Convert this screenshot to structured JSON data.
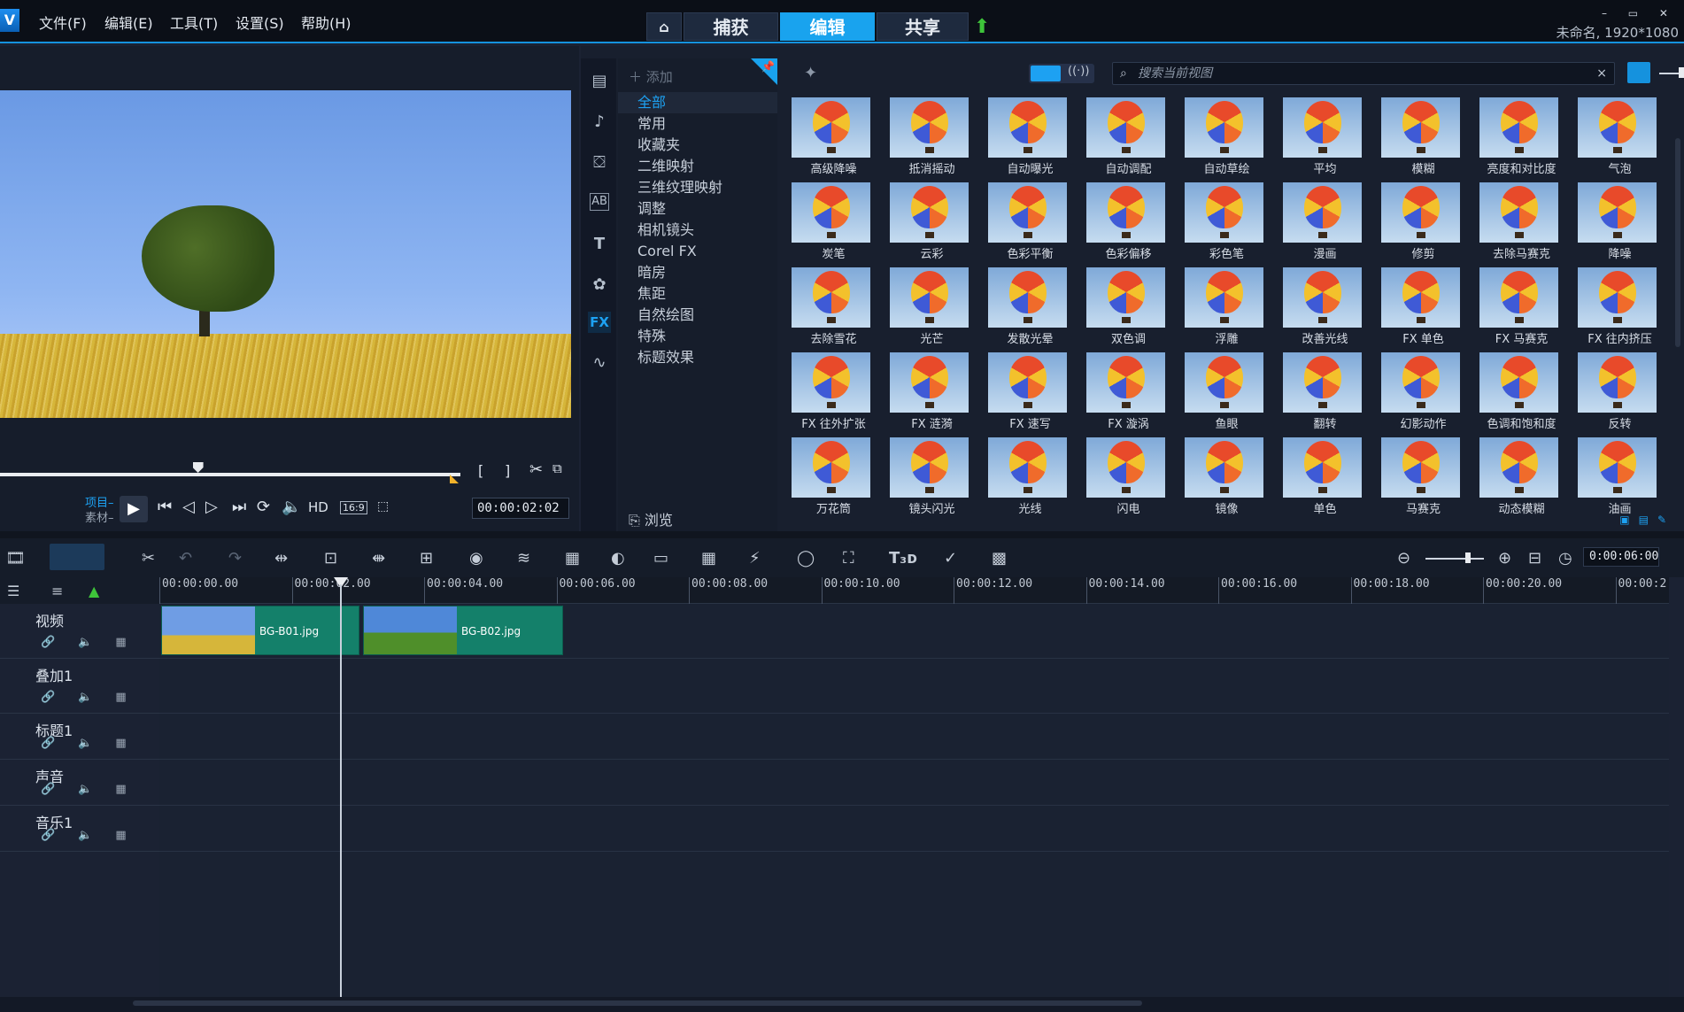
{
  "app": {
    "project_info": "未命名, 1920*1080",
    "window_controls": "– ▭ ✕"
  },
  "menu": [
    "文件(F)",
    "编辑(E)",
    "工具(T)",
    "设置(S)",
    "帮助(H)"
  ],
  "tabs": {
    "home": "⌂",
    "capture": "捕获",
    "edit": "编辑",
    "share": "共享",
    "active": "编辑"
  },
  "player": {
    "project_label": "项目–",
    "clip_label": "素材–",
    "timecode": "00:00:02:02",
    "hd_label": "HD",
    "aspect_label": "16:9",
    "scrub_position": 0.43
  },
  "library": {
    "add_label": "添加",
    "categories": [
      "全部",
      "常用",
      "收藏夹",
      "二维映射",
      "三维纹理映射",
      "调整",
      "相机镜头",
      "Corel FX",
      "暗房",
      "焦距",
      "自然绘图",
      "特殊",
      "标题效果"
    ],
    "selected_category": "全部",
    "browse_label": "浏览",
    "search_placeholder": "搜索当前视图",
    "sidebar_active": "FX",
    "effects": [
      "高级降噪",
      "抵消摇动",
      "自动曝光",
      "自动调配",
      "自动草绘",
      "平均",
      "模糊",
      "亮度和对比度",
      "气泡",
      "炭笔",
      "云彩",
      "色彩平衡",
      "色彩偏移",
      "彩色笔",
      "漫画",
      "修剪",
      "去除马赛克",
      "降噪",
      "去除雪花",
      "光芒",
      "发散光晕",
      "双色调",
      "浮雕",
      "改善光线",
      "FX 单色",
      "FX 马赛克",
      "FX 往内挤压",
      "FX 往外扩张",
      "FX 涟漪",
      "FX 速写",
      "FX 漩涡",
      "鱼眼",
      "翻转",
      "幻影动作",
      "色调和饱和度",
      "反转",
      "万花筒",
      "镜头闪光",
      "光线",
      "闪电",
      "镜像",
      "单色",
      "马赛克",
      "动态模糊",
      "油画"
    ]
  },
  "timeline": {
    "duration": "0:00:06:00",
    "ruler": [
      "00:00:00.00",
      "00:00:02.00",
      "00:00:04.00",
      "00:00:06.00",
      "00:00:08.00",
      "00:00:10.00",
      "00:00:12.00",
      "00:00:14.00",
      "00:00:16.00",
      "00:00:18.00",
      "00:00:20.00",
      "00:00:2"
    ],
    "tracks": [
      "视频",
      "叠加1",
      "标题1",
      "声音",
      "音乐1"
    ],
    "clips": [
      "BG-B01.jpg",
      "BG-B02.jpg"
    ]
  },
  "colors": {
    "accent": "#19a3ee",
    "clip": "#14806a",
    "background": "#1b2233"
  }
}
